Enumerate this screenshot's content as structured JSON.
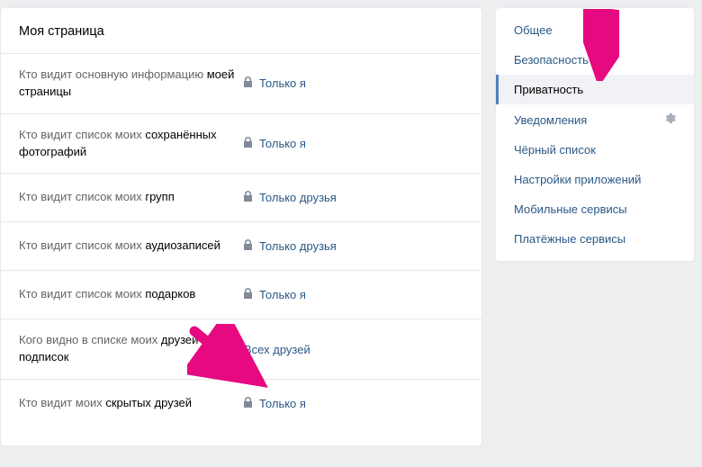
{
  "main": {
    "title": "Моя страница",
    "rows": [
      {
        "label_pre": "Кто видит основную информацию ",
        "label_bold": "моей страницы",
        "locked": true,
        "value": "Только я"
      },
      {
        "label_pre": "Кто видит список моих ",
        "label_bold": "сохранённых фотографий",
        "locked": true,
        "value": "Только я"
      },
      {
        "label_pre": "Кто видит список моих ",
        "label_bold": "групп",
        "locked": true,
        "value": "Только друзья"
      },
      {
        "label_pre": "Кто видит список моих ",
        "label_bold": "аудиозаписей",
        "locked": true,
        "value": "Только друзья"
      },
      {
        "label_pre": "Кто видит список моих ",
        "label_bold": "подарков",
        "locked": true,
        "value": "Только я"
      },
      {
        "label_pre": "Кого видно в списке моих ",
        "label_bold": "друзей и подписок",
        "locked": false,
        "value": "Всех друзей"
      },
      {
        "label_pre": "Кто видит моих ",
        "label_bold": "скрытых друзей",
        "locked": true,
        "value": "Только я"
      }
    ]
  },
  "sidebar": {
    "items": [
      {
        "label": "Общее",
        "selected": false,
        "gear": false
      },
      {
        "label": "Безопасность",
        "selected": false,
        "gear": false
      },
      {
        "label": "Приватность",
        "selected": true,
        "gear": false
      },
      {
        "label": "Уведомления",
        "selected": false,
        "gear": true
      },
      {
        "label": "Чёрный список",
        "selected": false,
        "gear": false
      },
      {
        "label": "Настройки приложений",
        "selected": false,
        "gear": false
      },
      {
        "label": "Мобильные сервисы",
        "selected": false,
        "gear": false
      },
      {
        "label": "Платёжные сервисы",
        "selected": false,
        "gear": false
      }
    ]
  },
  "colors": {
    "link": "#2a5885",
    "accent": "#5181b8",
    "arrow": "#e6097f"
  }
}
